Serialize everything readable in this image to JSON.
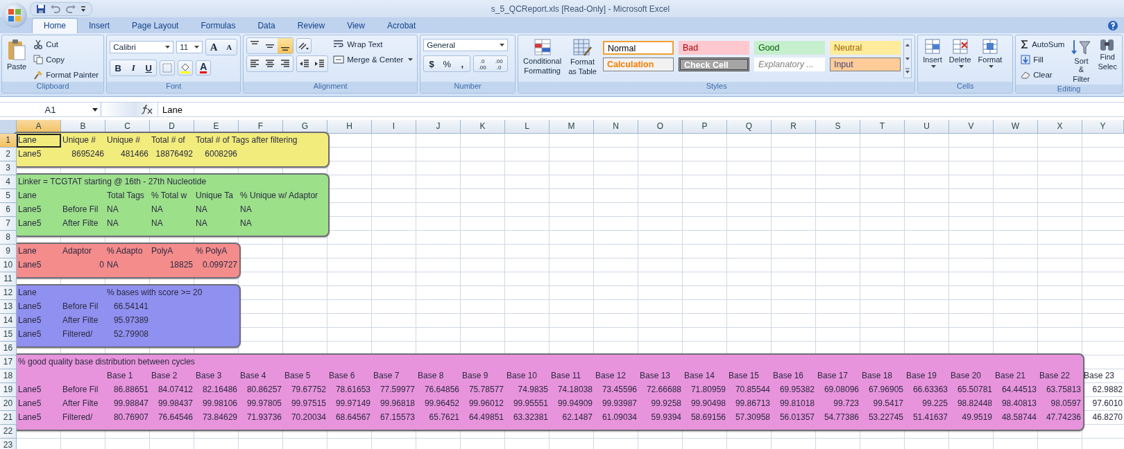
{
  "window": {
    "title": "s_5_QCReport.xls  [Read-Only] - Microsoft Excel"
  },
  "tabs": [
    {
      "label": "Home",
      "selected": true
    },
    {
      "label": "Insert",
      "selected": false
    },
    {
      "label": "Page Layout",
      "selected": false
    },
    {
      "label": "Formulas",
      "selected": false
    },
    {
      "label": "Data",
      "selected": false
    },
    {
      "label": "Review",
      "selected": false
    },
    {
      "label": "View",
      "selected": false
    },
    {
      "label": "Acrobat",
      "selected": false
    }
  ],
  "clipboard": {
    "title": "Clipboard",
    "paste": "Paste",
    "cut": "Cut",
    "copy": "Copy",
    "format_painter": "Format Painter"
  },
  "font": {
    "title": "Font",
    "family": "Calibri",
    "size": "11",
    "grow": "A",
    "shrink": "A",
    "bold": "B",
    "italic": "I",
    "underline": "U",
    "font_color": "A"
  },
  "alignment": {
    "title": "Alignment",
    "vertical_buttons": [
      {
        "selected": false
      },
      {
        "selected": false
      },
      {
        "selected": true
      }
    ],
    "wrap_text": "Wrap Text",
    "merge_center": "Merge & Center"
  },
  "number": {
    "title": "Number",
    "format": "General",
    "currency": "$",
    "percent": "%",
    "comma": ",",
    "decimal_buttons": [
      [
        ".0",
        ".00"
      ],
      [
        ".00",
        ".0"
      ]
    ]
  },
  "styles": {
    "title": "Styles",
    "conditional": [
      "Conditional",
      "Formatting"
    ],
    "format_table": [
      "Format",
      "as Table"
    ],
    "cells": [
      {
        "label": "Normal",
        "kind": "normal",
        "selected": true
      },
      {
        "label": "Bad",
        "kind": "bad",
        "selected": false
      },
      {
        "label": "Good",
        "kind": "good",
        "selected": false
      },
      {
        "label": "Neutral",
        "kind": "neutral",
        "selected": false
      },
      {
        "label": "Calculation",
        "kind": "calculation",
        "selected": false
      },
      {
        "label": "Check Cell",
        "kind": "check",
        "selected": false
      },
      {
        "label": "Explanatory ...",
        "kind": "explanatory",
        "selected": false
      },
      {
        "label": "Input",
        "kind": "input",
        "selected": false
      }
    ]
  },
  "cells_group": {
    "title": "Cells",
    "buttons": [
      "Insert",
      "Delete",
      "Format"
    ]
  },
  "editing": {
    "title": "Editing",
    "autosum": "AutoSum",
    "fill": "Fill",
    "clear": "Clear",
    "sort": [
      "Sort &",
      "Filter"
    ],
    "find": [
      "Find",
      "Selec"
    ]
  },
  "formula_bar": {
    "name_box": "A1",
    "content": "Lane"
  },
  "columns": [
    "A",
    "B",
    "C",
    "D",
    "E",
    "F",
    "G",
    "H",
    "I",
    "J",
    "K",
    "L",
    "M",
    "N",
    "O",
    "P",
    "Q",
    "R",
    "S",
    "T",
    "U",
    "V",
    "W",
    "X",
    "Y"
  ],
  "rows": [
    {
      "number": "1",
      "color": "#f2ec7c",
      "cells": [
        {
          "value": "Lane",
          "kind": "text"
        },
        {
          "value": "Unique #",
          "kind": "text"
        },
        {
          "value": "Unique #",
          "kind": "text"
        },
        {
          "value": "Total # of",
          "kind": "text"
        },
        {
          "value": "Total # of Tags after filtering",
          "kind": "text"
        }
      ]
    },
    {
      "number": "2",
      "color": "#f2ec7c",
      "cells": [
        {
          "value": "Lane5",
          "kind": "text"
        },
        {
          "value": "8695246",
          "kind": "number"
        },
        {
          "value": "481466",
          "kind": "number"
        },
        {
          "value": "18876492",
          "kind": "number"
        },
        {
          "value": "6008296",
          "kind": "number"
        }
      ]
    },
    {
      "number": "3"
    },
    {
      "number": "4",
      "color": "#9ce08a",
      "cells": [
        {
          "value": "Linker = TCGTAT starting @ 16th - 27th Nucleotide",
          "kind": "text"
        }
      ]
    },
    {
      "number": "5",
      "color": "#9ce08a",
      "cells": [
        {
          "value": "Lane",
          "kind": "text"
        },
        null,
        {
          "value": "Total Tags",
          "kind": "text"
        },
        {
          "value": "% Total w",
          "kind": "text"
        },
        {
          "value": "Unique Ta",
          "kind": "text"
        },
        {
          "value": "% Unique w/ Adaptor",
          "kind": "text"
        }
      ]
    },
    {
      "number": "6",
      "color": "#9ce08a",
      "cells": [
        {
          "value": "Lane5",
          "kind": "text"
        },
        {
          "value": "Before Fil",
          "kind": "text"
        },
        {
          "value": "NA",
          "kind": "text"
        },
        {
          "value": "NA",
          "kind": "text"
        },
        {
          "value": "NA",
          "kind": "text"
        },
        {
          "value": "NA",
          "kind": "text"
        }
      ]
    },
    {
      "number": "7",
      "color": "#9ce08a",
      "cells": [
        {
          "value": "Lane5",
          "kind": "text"
        },
        {
          "value": "After Filte",
          "kind": "text"
        },
        {
          "value": "NA",
          "kind": "text"
        },
        {
          "value": "NA",
          "kind": "text"
        },
        {
          "value": "NA",
          "kind": "text"
        },
        {
          "value": "NA",
          "kind": "text"
        }
      ]
    },
    {
      "number": "8"
    },
    {
      "number": "9",
      "color": "#f48c8c",
      "cells": [
        {
          "value": "Lane",
          "kind": "text"
        },
        {
          "value": "Adaptor",
          "kind": "text"
        },
        {
          "value": "% Adapto",
          "kind": "text"
        },
        {
          "value": "PolyA",
          "kind": "text"
        },
        {
          "value": "% PolyA",
          "kind": "text"
        }
      ]
    },
    {
      "number": "10",
      "color": "#f48c8c",
      "cells": [
        {
          "value": "Lane5",
          "kind": "text"
        },
        {
          "value": "0",
          "kind": "number"
        },
        {
          "value": "NA",
          "kind": "text"
        },
        {
          "value": "18825",
          "kind": "number"
        },
        {
          "value": "0.099727",
          "kind": "number"
        }
      ]
    },
    {
      "number": "11"
    },
    {
      "number": "12",
      "color": "#9090f0",
      "cells": [
        {
          "value": "Lane",
          "kind": "text"
        },
        null,
        {
          "value": "% bases with score >= 20",
          "kind": "text"
        }
      ]
    },
    {
      "number": "13",
      "color": "#9090f0",
      "cells": [
        {
          "value": "Lane5",
          "kind": "text"
        },
        {
          "value": "Before Fil",
          "kind": "text"
        },
        {
          "value": "66.54141",
          "kind": "number"
        }
      ]
    },
    {
      "number": "14",
      "color": "#9090f0",
      "cells": [
        {
          "value": "Lane5",
          "kind": "text"
        },
        {
          "value": "After Filte",
          "kind": "text"
        },
        {
          "value": "95.97389",
          "kind": "number"
        }
      ]
    },
    {
      "number": "15",
      "color": "#9090f0",
      "cells": [
        {
          "value": "Lane5",
          "kind": "text"
        },
        {
          "value": "Filtered/",
          "kind": "text"
        },
        {
          "value": "52.79908",
          "kind": "number"
        }
      ]
    },
    {
      "number": "16"
    },
    {
      "number": "17",
      "color": "#e894dc",
      "cells": [
        {
          "value": "% good quality base distribution between cycles",
          "kind": "text"
        }
      ]
    },
    {
      "number": "18",
      "color": "#e894dc",
      "cells": [
        null,
        null,
        {
          "value": "Base 1",
          "kind": "text"
        },
        {
          "value": "Base 2",
          "kind": "text"
        },
        {
          "value": "Base 3",
          "kind": "text"
        },
        {
          "value": "Base 4",
          "kind": "text"
        },
        {
          "value": "Base 5",
          "kind": "text"
        },
        {
          "value": "Base 6",
          "kind": "text"
        },
        {
          "value": "Base 7",
          "kind": "text"
        },
        {
          "value": "Base 8",
          "kind": "text"
        },
        {
          "value": "Base 9",
          "kind": "text"
        },
        {
          "value": "Base 10",
          "kind": "text"
        },
        {
          "value": "Base 11",
          "kind": "text"
        },
        {
          "value": "Base 12",
          "kind": "text"
        },
        {
          "value": "Base 13",
          "kind": "text"
        },
        {
          "value": "Base 14",
          "kind": "text"
        },
        {
          "value": "Base 15",
          "kind": "text"
        },
        {
          "value": "Base 16",
          "kind": "text"
        },
        {
          "value": "Base 17",
          "kind": "text"
        },
        {
          "value": "Base 18",
          "kind": "text"
        },
        {
          "value": "Base 19",
          "kind": "text"
        },
        {
          "value": "Base 20",
          "kind": "text"
        },
        {
          "value": "Base 21",
          "kind": "text"
        },
        {
          "value": "Base 22",
          "kind": "text"
        },
        {
          "value": "Base 23",
          "kind": "text"
        }
      ]
    },
    {
      "number": "19",
      "color": "#e894dc",
      "cells": [
        {
          "value": "Lane5",
          "kind": "text"
        },
        {
          "value": "Before Fil",
          "kind": "text"
        },
        {
          "value": "86.88651",
          "kind": "number"
        },
        {
          "value": "84.07412",
          "kind": "number"
        },
        {
          "value": "82.16486",
          "kind": "number"
        },
        {
          "value": "80.86257",
          "kind": "number"
        },
        {
          "value": "79.67752",
          "kind": "number"
        },
        {
          "value": "78.61653",
          "kind": "number"
        },
        {
          "value": "77.59977",
          "kind": "number"
        },
        {
          "value": "76.64856",
          "kind": "number"
        },
        {
          "value": "75.78577",
          "kind": "number"
        },
        {
          "value": "74.9835",
          "kind": "number"
        },
        {
          "value": "74.18038",
          "kind": "number"
        },
        {
          "value": "73.45596",
          "kind": "number"
        },
        {
          "value": "72.66688",
          "kind": "number"
        },
        {
          "value": "71.80959",
          "kind": "number"
        },
        {
          "value": "70.85544",
          "kind": "number"
        },
        {
          "value": "69.95382",
          "kind": "number"
        },
        {
          "value": "69.08096",
          "kind": "number"
        },
        {
          "value": "67.96905",
          "kind": "number"
        },
        {
          "value": "66.63363",
          "kind": "number"
        },
        {
          "value": "65.50781",
          "kind": "number"
        },
        {
          "value": "64.44513",
          "kind": "number"
        },
        {
          "value": "63.75813",
          "kind": "number"
        },
        {
          "value": "62.9882",
          "kind": "number"
        }
      ]
    },
    {
      "number": "20",
      "color": "#e894dc",
      "cells": [
        {
          "value": "Lane5",
          "kind": "text"
        },
        {
          "value": "After Filte",
          "kind": "text"
        },
        {
          "value": "99.98847",
          "kind": "number"
        },
        {
          "value": "99.98437",
          "kind": "number"
        },
        {
          "value": "99.98106",
          "kind": "number"
        },
        {
          "value": "99.97805",
          "kind": "number"
        },
        {
          "value": "99.97515",
          "kind": "number"
        },
        {
          "value": "99.97149",
          "kind": "number"
        },
        {
          "value": "99.96818",
          "kind": "number"
        },
        {
          "value": "99.96452",
          "kind": "number"
        },
        {
          "value": "99.96012",
          "kind": "number"
        },
        {
          "value": "99.95551",
          "kind": "number"
        },
        {
          "value": "99.94909",
          "kind": "number"
        },
        {
          "value": "99.93987",
          "kind": "number"
        },
        {
          "value": "99.9258",
          "kind": "number"
        },
        {
          "value": "99.90498",
          "kind": "number"
        },
        {
          "value": "99.86713",
          "kind": "number"
        },
        {
          "value": "99.81018",
          "kind": "number"
        },
        {
          "value": "99.723",
          "kind": "number"
        },
        {
          "value": "99.5417",
          "kind": "number"
        },
        {
          "value": "99.225",
          "kind": "number"
        },
        {
          "value": "98.82448",
          "kind": "number"
        },
        {
          "value": "98.40813",
          "kind": "number"
        },
        {
          "value": "98.0597",
          "kind": "number"
        },
        {
          "value": "97.6010",
          "kind": "number"
        }
      ]
    },
    {
      "number": "21",
      "color": "#e894dc",
      "cells": [
        {
          "value": "Lane5",
          "kind": "text"
        },
        {
          "value": "Filtered/",
          "kind": "text"
        },
        {
          "value": "80.76907",
          "kind": "number"
        },
        {
          "value": "76.64546",
          "kind": "number"
        },
        {
          "value": "73.84629",
          "kind": "number"
        },
        {
          "value": "71.93736",
          "kind": "number"
        },
        {
          "value": "70.20034",
          "kind": "number"
        },
        {
          "value": "68.64567",
          "kind": "number"
        },
        {
          "value": "67.15573",
          "kind": "number"
        },
        {
          "value": "65.7621",
          "kind": "number"
        },
        {
          "value": "64.49851",
          "kind": "number"
        },
        {
          "value": "63.32381",
          "kind": "number"
        },
        {
          "value": "62.1487",
          "kind": "number"
        },
        {
          "value": "61.09034",
          "kind": "number"
        },
        {
          "value": "59.9394",
          "kind": "number"
        },
        {
          "value": "58.69156",
          "kind": "number"
        },
        {
          "value": "57.30958",
          "kind": "number"
        },
        {
          "value": "56.01357",
          "kind": "number"
        },
        {
          "value": "54.77386",
          "kind": "number"
        },
        {
          "value": "53.22745",
          "kind": "number"
        },
        {
          "value": "51.41637",
          "kind": "number"
        },
        {
          "value": "49.9519",
          "kind": "number"
        },
        {
          "value": "48.58744",
          "kind": "number"
        },
        {
          "value": "47.74236",
          "kind": "number"
        },
        {
          "value": "46.8270",
          "kind": "number"
        }
      ]
    },
    {
      "number": "22"
    },
    {
      "number": "23"
    }
  ]
}
